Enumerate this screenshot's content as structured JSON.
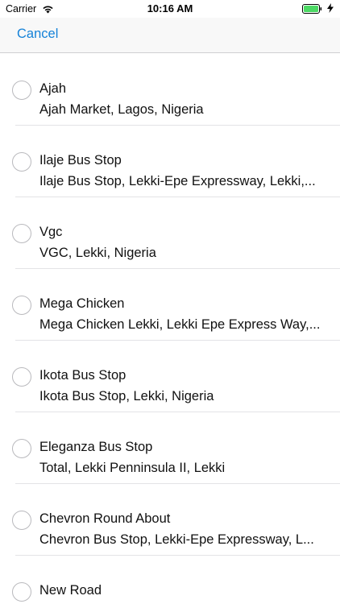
{
  "status_bar": {
    "carrier": "Carrier",
    "time": "10:16 AM",
    "battery_color": "#4cd964"
  },
  "nav": {
    "cancel_label": "Cancel",
    "accent_color": "#1582d8"
  },
  "places": [
    {
      "title": "Ajah",
      "subtitle": "Ajah Market, Lagos, Nigeria"
    },
    {
      "title": "Ilaje Bus Stop",
      "subtitle": "Ilaje Bus Stop, Lekki-Epe Expressway, Lekki,..."
    },
    {
      "title": "Vgc",
      "subtitle": "VGC, Lekki, Nigeria"
    },
    {
      "title": "Mega Chicken",
      "subtitle": "Mega Chicken Lekki, Lekki Epe Express Way,..."
    },
    {
      "title": "Ikota Bus Stop",
      "subtitle": "Ikota Bus Stop, Lekki, Nigeria"
    },
    {
      "title": "Eleganza Bus Stop",
      "subtitle": "Total, Lekki Penninsula II, Lekki"
    },
    {
      "title": "Chevron Round About",
      "subtitle": "Chevron Bus Stop, Lekki-Epe Expressway, L..."
    },
    {
      "title": "New Road",
      "subtitle": ""
    }
  ]
}
